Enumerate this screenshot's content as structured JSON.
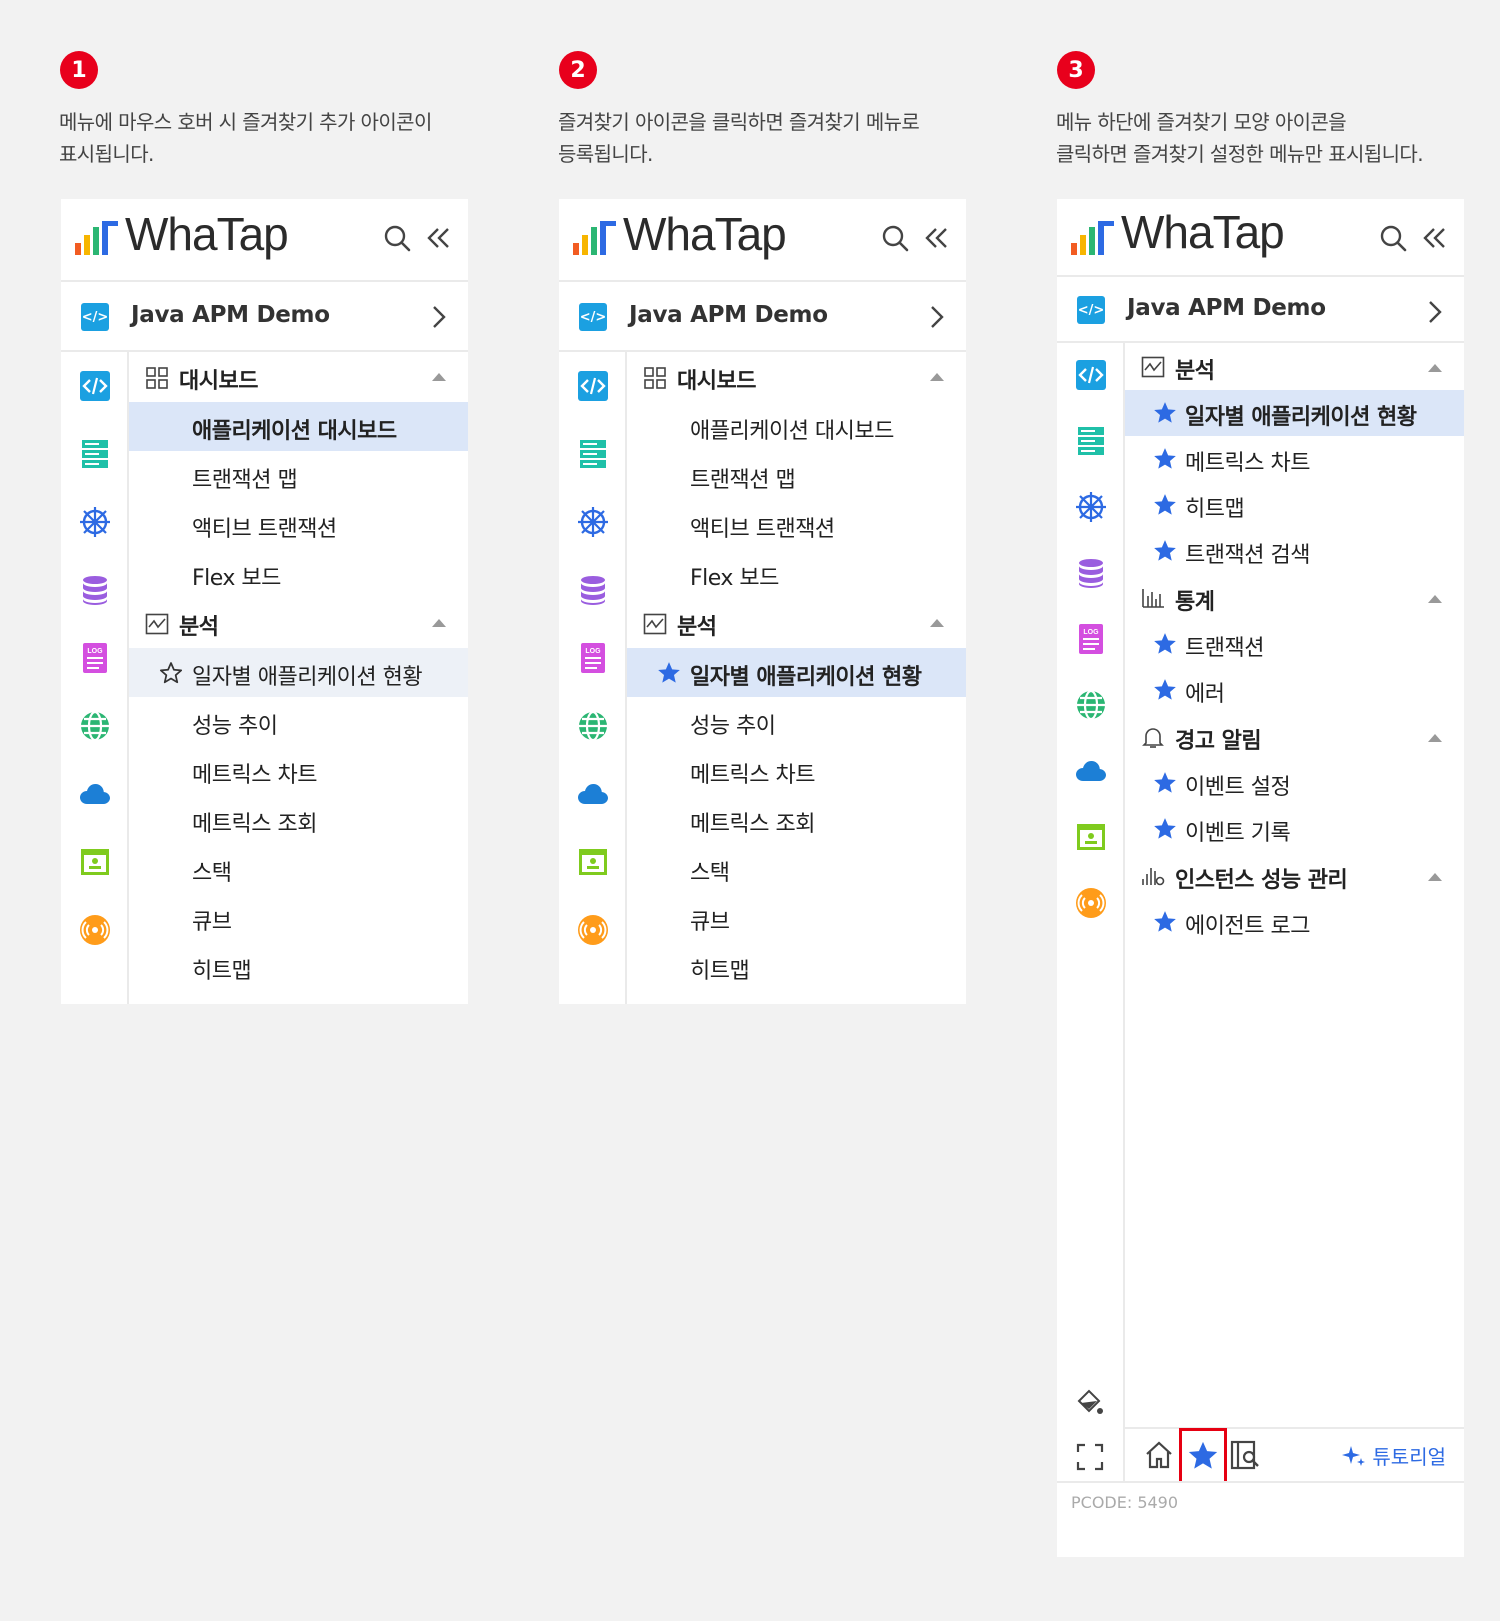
{
  "steps": [
    {
      "number": "1",
      "caption": "메뉴에 마우스 호버 시 즐겨찾기 추가 아이콘이\n표시됩니다."
    },
    {
      "number": "2",
      "caption": "즐겨찾기 아이콘을 클릭하면 즐겨찾기 메뉴로\n등록됩니다."
    },
    {
      "number": "3",
      "caption": "메뉴 하단에 즐겨찾기 모양 아이콘을\n클릭하면 즐겨찾기 설정한 메뉴만 표시됩니다."
    }
  ],
  "app": {
    "logo_text": "WhaTap",
    "project_name": "Java APM Demo",
    "project_icon": "</>"
  },
  "panel1": {
    "dashboard_section": "대시보드",
    "dashboard_items": [
      "애플리케이션 대시보드",
      "트랜잭션 맵",
      "액티브 트랜잭션",
      "Flex 보드"
    ],
    "analysis_section": "분석",
    "analysis_items": [
      "일자별 애플리케이션 현황",
      "성능 추이",
      "메트릭스 차트",
      "메트릭스 조회",
      "스택",
      "큐브",
      "히트맵"
    ]
  },
  "panel2": {
    "dashboard_section": "대시보드",
    "dashboard_items": [
      "애플리케이션 대시보드",
      "트랜잭션 맵",
      "액티브 트랜잭션",
      "Flex 보드"
    ],
    "analysis_section": "분석",
    "analysis_items": [
      "일자별 애플리케이션 현황",
      "성능 추이",
      "메트릭스 차트",
      "메트릭스 조회",
      "스택",
      "큐브",
      "히트맵"
    ]
  },
  "panel3": {
    "analysis_section": "분석",
    "analysis_items": [
      "일자별 애플리케이션 현황",
      "메트릭스 차트",
      "히트맵",
      "트랜잭션 검색"
    ],
    "stats_section": "통계",
    "stats_items": [
      "트랜잭션",
      "에러"
    ],
    "alert_section": "경고 알림",
    "alert_items": [
      "이벤트 설정",
      "이벤트 기록"
    ],
    "instance_section": "인스턴스 성능 관리",
    "instance_items": [
      "에이전트 로그"
    ],
    "tutorial_label": "튜토리얼",
    "pcode": "PCODE: 5490"
  },
  "colors": {
    "accent": "#2d6ae3",
    "active_bg": "#dbe6f8",
    "step_badge": "#e8001c",
    "highlight_box": "#e60012"
  },
  "icons": [
    "logo-bars-icon",
    "search-icon",
    "collapse-icon",
    "code-icon",
    "server-icon",
    "kubernetes-icon",
    "database-icon",
    "log-icon",
    "globe-icon",
    "cloud-icon",
    "browser-icon",
    "radio-icon",
    "star-icon",
    "grid-icon",
    "chart-icon",
    "bar-chart-icon",
    "bell-icon",
    "instance-icon",
    "paint-icon",
    "fullscreen-icon",
    "home-icon",
    "report-icon",
    "sparkle-icon"
  ]
}
